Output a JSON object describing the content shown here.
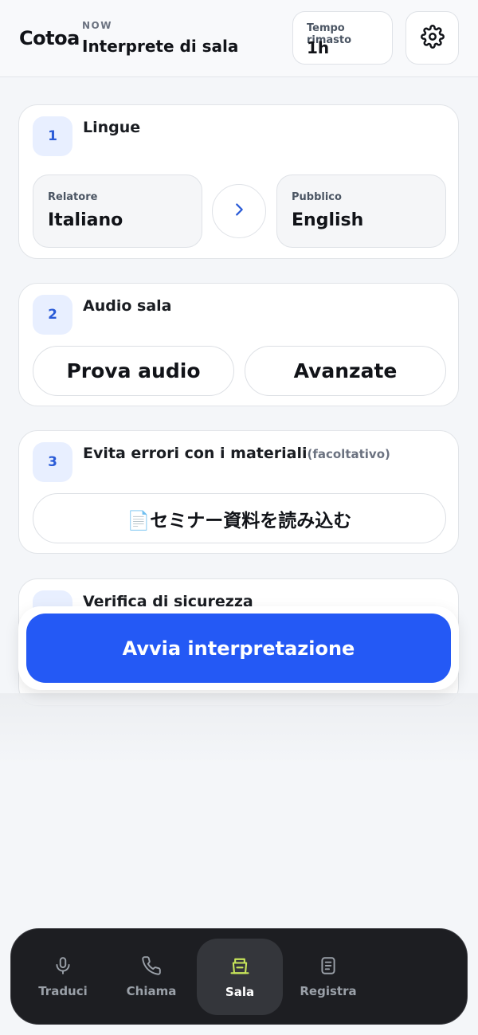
{
  "header": {
    "brand": "Cotoa",
    "mode": "NOW",
    "title": "Interprete di sala",
    "time_label": "Tempo rimasto",
    "time_value": "1h",
    "settings_icon": "gear-icon"
  },
  "steps": [
    {
      "number": "1",
      "title": "Lingue",
      "speaker_label": "Relatore",
      "speaker_value": "Italiano",
      "audience_label": "Pubblico",
      "audience_value": "English",
      "swap_icon": "chevron-right-icon"
    },
    {
      "number": "2",
      "title": "Audio sala",
      "test_label": "Prova audio",
      "advanced_label": "Avanzate"
    },
    {
      "number": "3",
      "title": "Evita errori con i materiali",
      "optional": "(facoltativo)",
      "load_label": "📄セミナー資料を読み込む"
    },
    {
      "title": "Verifica di sicurezza"
    }
  ],
  "cta": {
    "label": "Avvia interpretazione"
  },
  "colors": {
    "accent": "#2459f5",
    "badge_bg": "#e8efff",
    "nav_bg": "#1d1e22",
    "active_icon": "#c8e65a"
  },
  "nav": [
    {
      "label": "Traduci",
      "icon": "microphone-icon",
      "active": false
    },
    {
      "label": "Chiama",
      "icon": "phone-icon",
      "active": false
    },
    {
      "label": "Sala",
      "icon": "podium-icon",
      "active": true
    },
    {
      "label": "Registra",
      "icon": "document-icon",
      "active": false
    }
  ]
}
